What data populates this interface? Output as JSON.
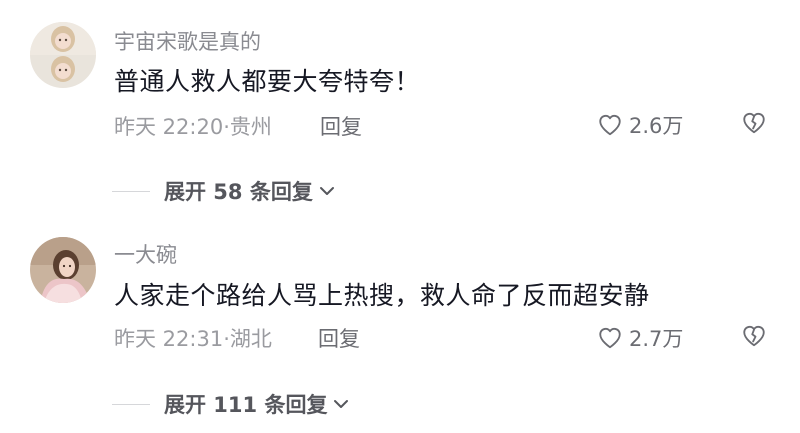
{
  "comments": [
    {
      "username": "宇宙宋歌是真的",
      "content": "普通人救人都要大夸特夸！",
      "meta": "昨天 22:20·贵州",
      "reply_label": "回复",
      "like_count": "2.6万",
      "expand_label": "展开 58 条回复"
    },
    {
      "username": "一大碗",
      "content": "人家走个路给人骂上热搜，救人命了反而超安静",
      "meta": "昨天 22:31·湖北",
      "reply_label": "回复",
      "like_count": "2.7万",
      "expand_label": "展开 111 条回复"
    }
  ],
  "icons": {
    "like": "heart-outline-icon",
    "dislike": "broken-heart-icon",
    "expand": "chevron-down-icon"
  },
  "colors": {
    "username": "#8a8b91",
    "content": "#161823",
    "meta": "#9a9ba0",
    "action": "#6b6c72"
  }
}
